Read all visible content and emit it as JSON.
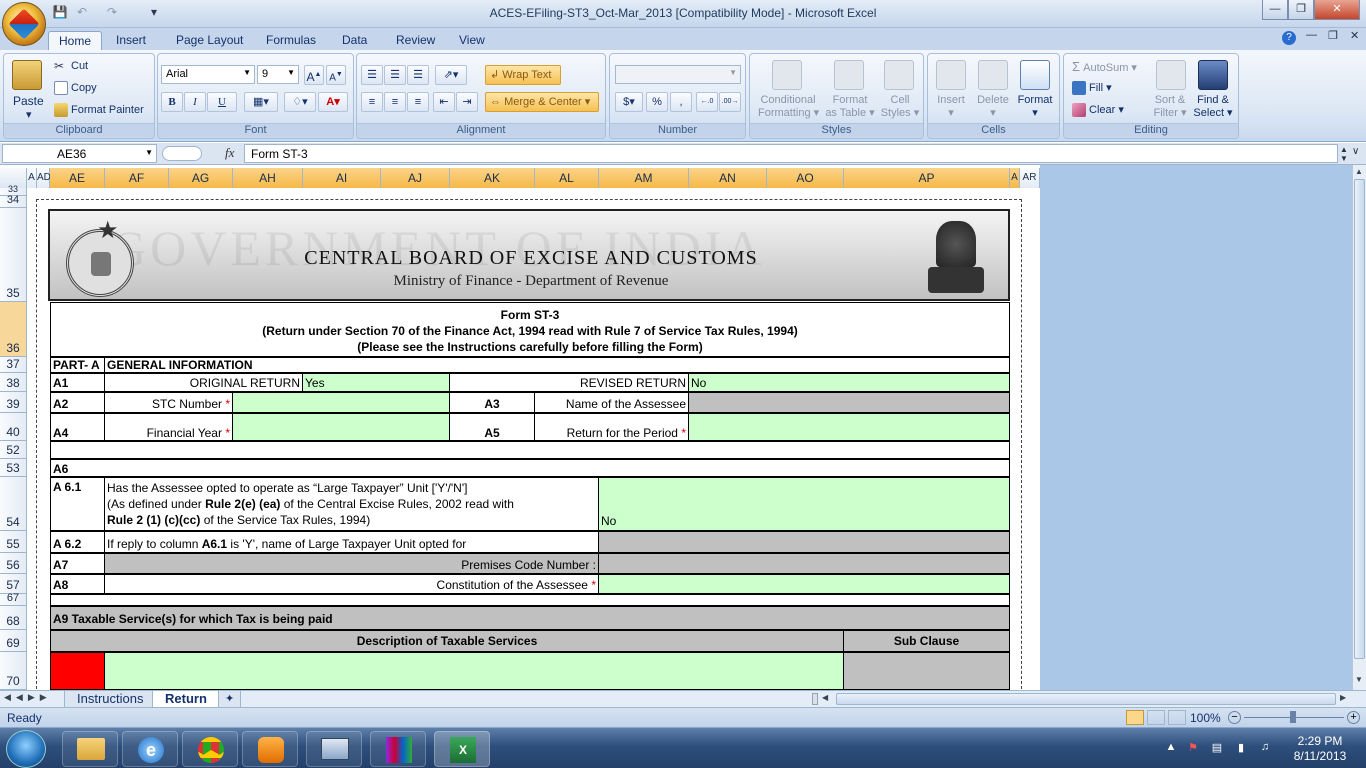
{
  "window": {
    "title": "ACES-EFiling-ST3_Oct-Mar_2013  [Compatibility Mode] - Microsoft Excel"
  },
  "ribbon_tabs": [
    "Home",
    "Insert",
    "Page Layout",
    "Formulas",
    "Data",
    "Review",
    "View"
  ],
  "clipboard": {
    "paste": "Paste",
    "cut": "Cut",
    "copy": "Copy",
    "format_painter": "Format Painter",
    "label": "Clipboard"
  },
  "font": {
    "name": "Arial",
    "size": "9",
    "label": "Font",
    "bold": "B",
    "italic": "I",
    "underline": "U",
    "font_color": "A"
  },
  "alignment": {
    "wrap": "Wrap Text",
    "merge": "Merge & Center",
    "label": "Alignment"
  },
  "number": {
    "label": "Number",
    "currency": "$",
    "percent": "%",
    "comma": ",",
    "inc_dec": ".0→.00",
    "dec_dec": ".00→.0"
  },
  "styles": {
    "conditional": "Conditional",
    "conditional2": "Formatting",
    "format_table": "Format",
    "format_table2": "as Table",
    "cell_styles": "Cell",
    "cell_styles2": "Styles",
    "label": "Styles"
  },
  "cells": {
    "insert": "Insert",
    "delete": "Delete",
    "format": "Format",
    "label": "Cells"
  },
  "editing": {
    "autosum": "AutoSum",
    "fill": "Fill",
    "clear": "Clear",
    "sort": "Sort &",
    "sort2": "Filter",
    "find": "Find &",
    "find2": "Select",
    "label": "Editing"
  },
  "formula_bar": {
    "name_box": "AE36",
    "fx": "fx",
    "content": "Form ST-3"
  },
  "columns": [
    "A",
    "AD",
    "AE",
    "AF",
    "AG",
    "AH",
    "AI",
    "AJ",
    "AK",
    "AL",
    "AM",
    "AN",
    "AO",
    "AP",
    "A",
    "AR"
  ],
  "rows": [
    "33",
    "34",
    "35",
    "36",
    "37",
    "38",
    "39",
    "40",
    "52",
    "53",
    "54",
    "55",
    "56",
    "57",
    "67",
    "68",
    "69",
    "70"
  ],
  "banner": {
    "watermark": "GOVERNMENT OF INDIA",
    "org": "CENTRAL BOARD OF EXCISE AND CUSTOMS",
    "ministry": "Ministry of Finance  - Department of Revenue"
  },
  "form": {
    "title": "Form ST-3",
    "subtitle": "(Return under Section 70 of the Finance Act, 1994 read with Rule 7 of Service Tax Rules, 1994)",
    "note": "(Please see the Instructions carefully before filling the Form)",
    "part": "PART- A",
    "general": "GENERAL INFORMATION",
    "a1": "A1",
    "original": "ORIGINAL RETURN",
    "original_val": "Yes",
    "revised": "REVISED RETURN",
    "revised_val": "No",
    "a2": "A2",
    "stc": "STC Number",
    "a3": "A3",
    "assessee_name": "Name of the Assessee",
    "a4": "A4",
    "fin_year": "Financial Year",
    "a5": "A5",
    "period": "Return for the Period",
    "a6": "A6",
    "a61": "A 6.1",
    "a61_l1": "Has the Assessee opted to operate as “Large Taxpayer” Unit ['Y'/'N']",
    "a61_l2_pre": "(As defined under ",
    "a61_l2_bold": "Rule 2(e) (ea)",
    "a61_l2_post": " of the Central Excise Rules, 2002 read with",
    "a61_l3_bold": "Rule 2 (1) (c)(cc)",
    "a61_l3_post": " of the Service Tax Rules, 1994)",
    "a61_val": "No",
    "a62": "A 6.2",
    "a62_pre": "If reply to column ",
    "a62_bold": "A6.1",
    "a62_post": " is 'Y', name of Large Taxpayer Unit opted for",
    "a7": "A7",
    "premises": "Premises Code Number :",
    "a8": "A8",
    "constitution": "Constitution of the Assessee",
    "a9": "A9   Taxable Service(s) for which Tax is being paid",
    "desc_hdr": "Description of Taxable Services",
    "sub_hdr": "Sub Clause",
    "req": "*"
  },
  "sheet_tabs": [
    "Instructions",
    "Return"
  ],
  "status": {
    "ready": "Ready",
    "zoom": "100%"
  },
  "clock": {
    "time": "2:29 PM",
    "date": "8/11/2013"
  }
}
